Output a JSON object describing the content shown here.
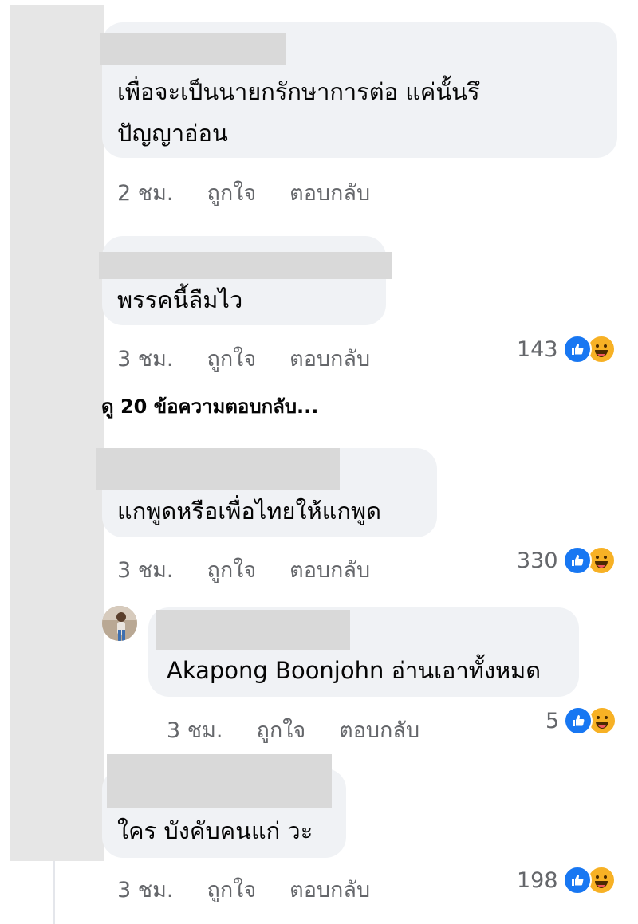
{
  "comments": [
    {
      "text_line1": "เพื่อจะเป็นนายกรักษาการต่อ  แค่นั้นรึ",
      "text_line2": "ปัญญาอ่อน",
      "time": "2 ชม.",
      "like_label": "ถูกใจ",
      "reply_label": "ตอบกลับ"
    },
    {
      "text_line1": "พรรคนี้ลืมไว",
      "time": "3 ชม.",
      "like_label": "ถูกใจ",
      "reply_label": "ตอบกลับ",
      "reaction_count": "143",
      "reaction_icons": [
        "like-icon",
        "haha-icon"
      ]
    },
    {
      "text_line1": "แกพูดหรือเพื่อไทยให้แกพูด",
      "time": "3 ชม.",
      "like_label": "ถูกใจ",
      "reply_label": "ตอบกลับ",
      "reaction_count": "330",
      "reaction_icons": [
        "like-icon",
        "haha-icon"
      ]
    },
    {
      "text_line1": "Akapong Boonjohn อ่านเอาทั้งหมด",
      "time": "3 ชม.",
      "like_label": "ถูกใจ",
      "reply_label": "ตอบกลับ",
      "reaction_count": "5",
      "reaction_icons": [
        "like-icon",
        "haha-icon"
      ]
    },
    {
      "text_line1": "ใคร บังคับคนแก่ วะ",
      "time": "3 ชม.",
      "like_label": "ถูกใจ",
      "reply_label": "ตอบกลับ",
      "reaction_count": "198",
      "reaction_icons": [
        "like-icon",
        "haha-icon"
      ]
    }
  ],
  "more_replies": "ดู 20 ข้อความตอบกลับ...",
  "colors": {
    "bubble": "#f0f2f5",
    "meta_text": "#65676b",
    "like": "#1877f2",
    "haha": "#f7b125",
    "redaction": "#d9d9d9"
  }
}
